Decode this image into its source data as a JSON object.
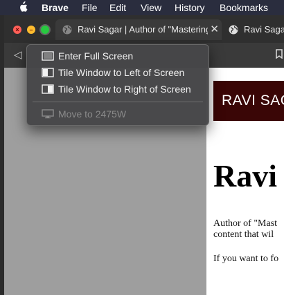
{
  "menubar": {
    "app_name": "Brave",
    "items": [
      "File",
      "Edit",
      "View",
      "History",
      "Bookmarks"
    ]
  },
  "tabs": [
    {
      "title": "Ravi Sagar | Author of \"Mastering"
    },
    {
      "title": "Ravi Sagar"
    }
  ],
  "window_menu": {
    "items": [
      {
        "label": "Enter Full Screen",
        "icon": "full-screen-icon"
      },
      {
        "label": "Tile Window to Left of Screen",
        "icon": "tile-left-icon"
      },
      {
        "label": "Tile Window to Right of Screen",
        "icon": "tile-right-icon"
      }
    ],
    "move_item": {
      "label": "Move to 2475W",
      "icon": "display-icon"
    }
  },
  "page": {
    "banner": "RAVI SAGA",
    "heading": "Ravi",
    "para1_line1": "Author of \"Mast",
    "para1_line2": "content that wil",
    "para2": "If you want to fo"
  },
  "colors": {
    "menubar_bg": "#2a2d3e",
    "banner_bg": "#3a0606",
    "close": "#ff5f57",
    "minimize": "#febc2e",
    "maximize": "#28c840"
  }
}
